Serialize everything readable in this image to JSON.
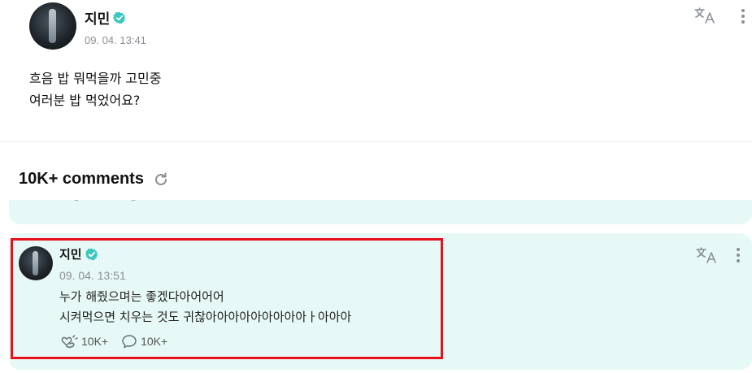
{
  "post": {
    "author": "지민",
    "timestamp": "09. 04. 13:41",
    "body_lines": [
      "흐음 밥 뭐먹을까 고민중",
      "여러분 밥 먹었어요?"
    ]
  },
  "comments": {
    "title": "10K+ comments"
  },
  "comment": {
    "author": "지민",
    "timestamp": "09. 04. 13:51",
    "body_lines": [
      "누가 해줬으며는 좋겠다아어어어",
      "시켜먹으면 치우는 것도 귀찮아아아아아아아아아ㅏ아아아"
    ],
    "like_count": "10K+",
    "reply_count": "10K+"
  },
  "icons": {
    "verified": "verified-badge-icon",
    "translate": "translate-icon",
    "more": "more-vertical-icon",
    "refresh": "refresh-icon",
    "like": "heart-hands-icon",
    "reply": "comment-bubble-icon"
  },
  "colors": {
    "accent_teal": "#3cc8c0",
    "card_bg": "#e6f9f6",
    "highlight_red": "#e8101a",
    "muted_text": "#8a8f95"
  }
}
